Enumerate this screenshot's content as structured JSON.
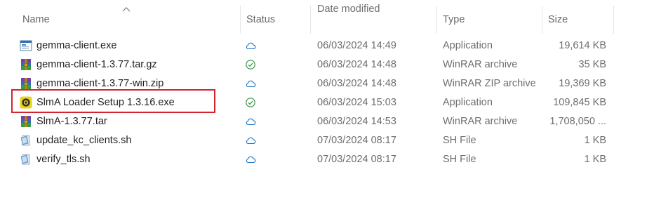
{
  "columns": {
    "name": "Name",
    "status": "Status",
    "date_modified": "Date modified",
    "type": "Type",
    "size": "Size"
  },
  "sort": {
    "column": "name",
    "direction": "ascending"
  },
  "files": [
    {
      "name": "gemma-client.exe",
      "icon": "application-window-icon",
      "status": "cloud",
      "date": "06/03/2024 14:49",
      "type": "Application",
      "size": "19,614 KB"
    },
    {
      "name": "gemma-client-1.3.77.tar.gz",
      "icon": "winrar-archive-icon",
      "status": "synced",
      "date": "06/03/2024 14:48",
      "type": "WinRAR archive",
      "size": "35 KB"
    },
    {
      "name": "gemma-client-1.3.77-win.zip",
      "icon": "winrar-archive-icon",
      "status": "cloud",
      "date": "06/03/2024 14:48",
      "type": "WinRAR ZIP archive",
      "size": "19,369 KB"
    },
    {
      "name": "SlmA Loader Setup 1.3.16.exe",
      "icon": "slma-app-icon",
      "status": "synced",
      "date": "06/03/2024 15:03",
      "type": "Application",
      "size": "109,845 KB"
    },
    {
      "name": "SlmA-1.3.77.tar",
      "icon": "winrar-archive-icon",
      "status": "cloud",
      "date": "06/03/2024 14:53",
      "type": "WinRAR archive",
      "size": "1,708,050 ..."
    },
    {
      "name": "update_kc_clients.sh",
      "icon": "sh-script-icon",
      "status": "cloud",
      "date": "07/03/2024 08:17",
      "type": "SH File",
      "size": "1 KB"
    },
    {
      "name": "verify_tls.sh",
      "icon": "sh-script-icon",
      "status": "cloud",
      "date": "07/03/2024 08:17",
      "type": "SH File",
      "size": "1 KB"
    }
  ],
  "highlighted_row": 3,
  "colors": {
    "highlight_border": "#d4242f",
    "cloud_status": "#1a73c7",
    "synced_status": "#2e8b3e",
    "header_text": "#6a6a6a",
    "name_text": "#1f1f1f",
    "secondary_text": "#6e6e6e"
  }
}
